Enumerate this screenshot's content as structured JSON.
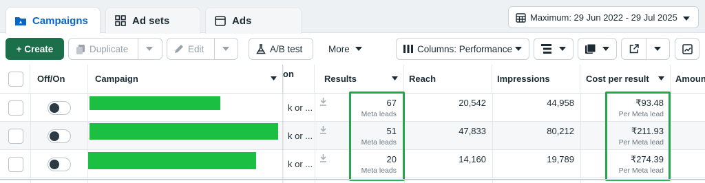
{
  "tabs": {
    "campaigns": "Campaigns",
    "ad_sets": "Ad sets",
    "ads": "Ads"
  },
  "date_range": "Maximum: 29 Jun 2022 - 29 Jul 2025",
  "toolbar": {
    "create": "+ Create",
    "duplicate": "Duplicate",
    "edit": "Edit",
    "ab_test": "A/B test",
    "more": "More",
    "columns": "Columns: Performance"
  },
  "table": {
    "headers": {
      "off_on": "Off/On",
      "campaign": "Campaign",
      "delivery_fragment": "on",
      "results": "Results",
      "reach": "Reach",
      "impressions": "Impressions",
      "cost_per_result": "Cost per result",
      "amount": "Amoun"
    },
    "rows": [
      {
        "delivery": "k or ...",
        "results": "67",
        "results_sub": "Meta leads",
        "reach": "20,542",
        "impressions": "44,958",
        "cost": "₹93.48",
        "cost_sub": "Per Meta lead"
      },
      {
        "delivery": "k or ...",
        "results": "51",
        "results_sub": "Meta leads",
        "reach": "47,833",
        "impressions": "80,212",
        "cost": "₹211.93",
        "cost_sub": "Per Meta lead"
      },
      {
        "delivery": "k or ...",
        "results": "20",
        "results_sub": "Meta leads",
        "reach": "14,160",
        "impressions": "19,789",
        "cost": "₹274.39",
        "cost_sub": "Per Meta lead"
      }
    ]
  },
  "colors": {
    "primary_green": "#1b6f4a",
    "highlight_green": "#21a84a",
    "redaction_green": "#1bbf42",
    "tab_blue": "#0a66c2"
  }
}
